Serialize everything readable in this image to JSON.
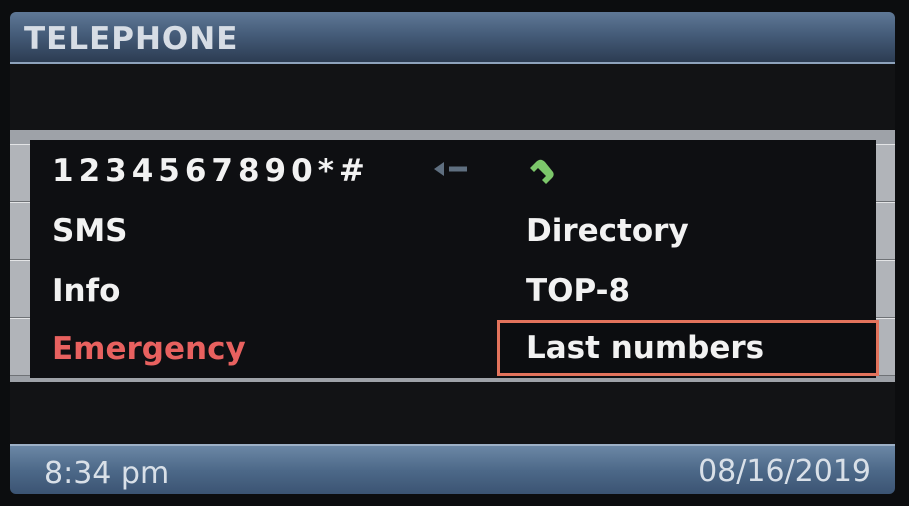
{
  "header": {
    "title": "TELEPHONE"
  },
  "keypad": {
    "digits": "1234567890*#",
    "backspace_icon": "backspace-arrow-icon",
    "call_icon": "phone-handset-icon"
  },
  "menu": {
    "left": {
      "sms": "SMS",
      "info": "Info",
      "emergency": "Emergency"
    },
    "right": {
      "directory": "Directory",
      "top8": "TOP-8",
      "last_numbers": "Last numbers"
    },
    "selected": "Last numbers"
  },
  "status": {
    "time": "8:34 pm",
    "date": "08/16/2019"
  },
  "colors": {
    "titlebar": "#455c79",
    "emergency_text": "#e8615f",
    "selection_border": "#e3735c",
    "call_icon": "#7cc76a"
  }
}
